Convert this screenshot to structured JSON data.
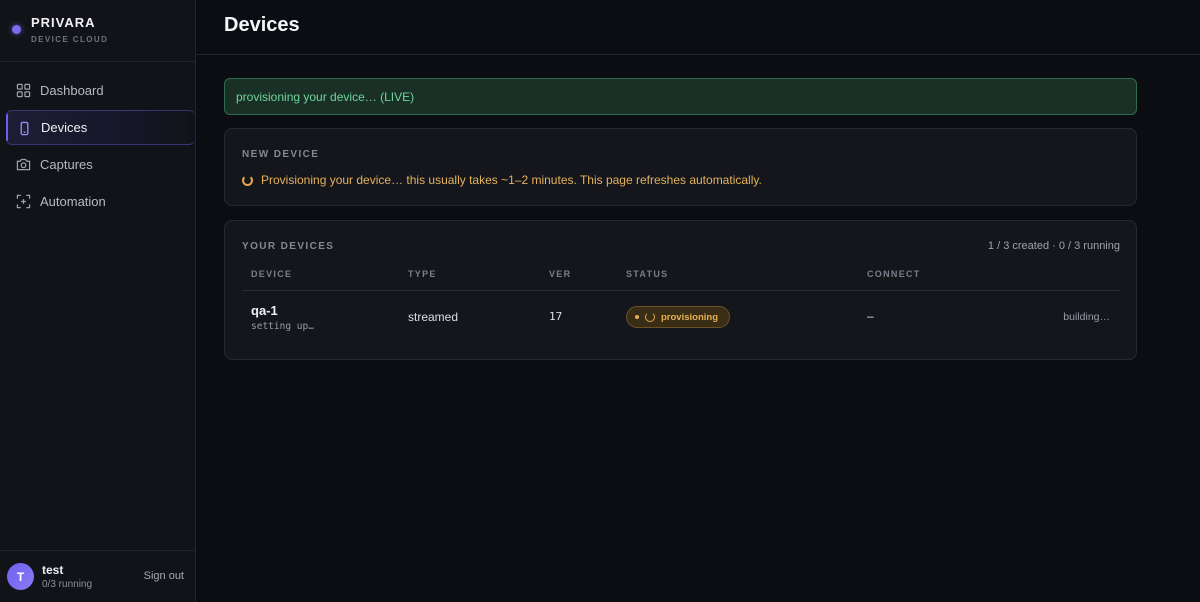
{
  "brand": {
    "name": "PRIVARA",
    "subtitle": "DEVICE CLOUD"
  },
  "sidebar": {
    "items": [
      {
        "label": "Dashboard",
        "icon": "grid-icon",
        "active": false
      },
      {
        "label": "Devices",
        "icon": "phone-icon",
        "active": true
      },
      {
        "label": "Captures",
        "icon": "camera-icon",
        "active": false
      },
      {
        "label": "Automation",
        "icon": "scan-icon",
        "active": false
      }
    ]
  },
  "user": {
    "initial": "T",
    "name": "test",
    "status": "0/3 running",
    "signout_label": "Sign out"
  },
  "header": {
    "title": "Devices"
  },
  "alert": {
    "text": "provisioning your device… (LIVE)"
  },
  "new_device": {
    "title": "NEW DEVICE",
    "message": "Provisioning your device… this usually takes ~1–2 minutes. This page refreshes automatically."
  },
  "devices": {
    "title": "YOUR DEVICES",
    "summary": "1 / 3 created · 0 / 3 running",
    "columns": [
      "DEVICE",
      "TYPE",
      "VER",
      "STATUS",
      "CONNECT"
    ],
    "rows": [
      {
        "name": "qa-1",
        "subtext": "setting up…",
        "type": "streamed",
        "version": "17",
        "status": "provisioning",
        "connect": "–",
        "action": "building…"
      }
    ]
  },
  "colors": {
    "accent": "#6e5ef0",
    "success": "#6fd49e",
    "warning": "#e3b25c",
    "background": "#0c0d12"
  }
}
